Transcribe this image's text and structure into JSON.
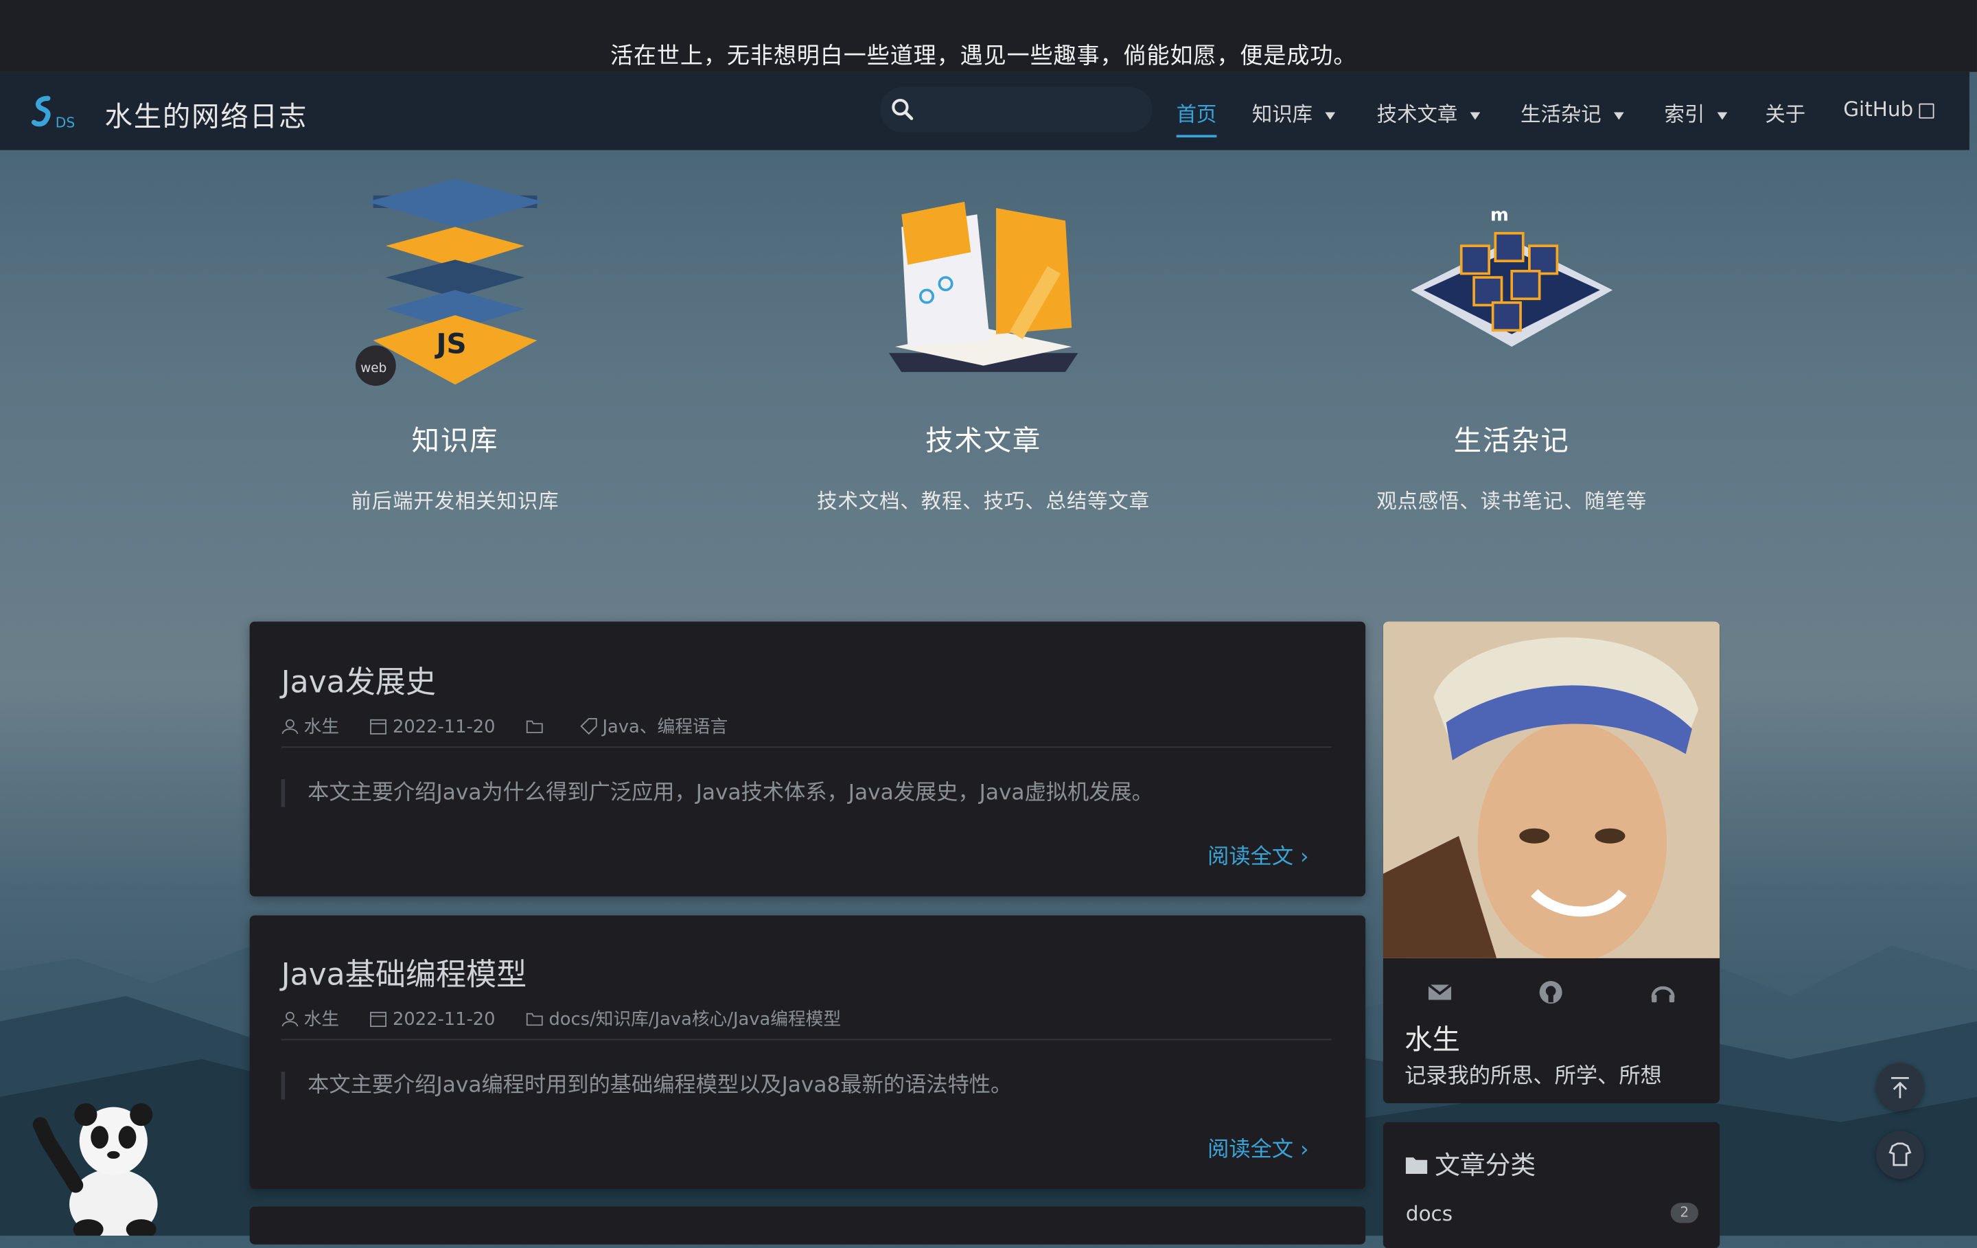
{
  "motto": "活在世上，无非想明白一些道理，遇见一些趣事，倘能如愿，便是成功。",
  "site": {
    "logo_text": "SDS",
    "title": "水生的网络日志"
  },
  "search": {
    "placeholder": ""
  },
  "nav": {
    "items": [
      {
        "label": "首页",
        "active": true
      },
      {
        "label": "知识库",
        "dropdown": true
      },
      {
        "label": "技术文章",
        "dropdown": true
      },
      {
        "label": "生活杂记",
        "dropdown": true
      },
      {
        "label": "索引",
        "dropdown": true
      },
      {
        "label": "关于"
      },
      {
        "label": "GitHub",
        "external": true
      }
    ]
  },
  "features": [
    {
      "title": "知识库",
      "desc": "前后端开发相关知识库",
      "icon": "layered-js-stack-icon"
    },
    {
      "title": "技术文章",
      "desc": "技术文档、教程、技巧、总结等文章",
      "icon": "open-book-pencil-icon"
    },
    {
      "title": "生活杂记",
      "desc": "观点感悟、读书笔记、随笔等",
      "icon": "cube-grid-icon"
    }
  ],
  "posts": [
    {
      "title": "Java发展史",
      "author": "水生",
      "date": "2022-11-20",
      "category": "",
      "tags": "Java、编程语言",
      "excerpt": "本文主要介绍Java为什么得到广泛应用，Java技术体系，Java发展史，Java虚拟机发展。",
      "readmore": "阅读全文"
    },
    {
      "title": "Java基础编程模型",
      "author": "水生",
      "date": "2022-11-20",
      "category": "docs/知识库/Java核心/Java编程模型",
      "tags": "",
      "excerpt": "本文主要介绍Java编程时用到的基础编程模型以及Java8最新的语法特性。",
      "readmore": "阅读全文"
    }
  ],
  "profile": {
    "name": "水生",
    "bio": "记录我的所思、所学、所想",
    "social_icons": [
      "mail-icon",
      "github-icon",
      "headphones-icon"
    ]
  },
  "categories": {
    "title": "文章分类",
    "items": [
      {
        "label": "docs",
        "count": "2"
      }
    ]
  },
  "colors": {
    "accent": "#3aa3d8",
    "card_bg": "#1e1e22",
    "nav_bg": "#1b2531"
  }
}
